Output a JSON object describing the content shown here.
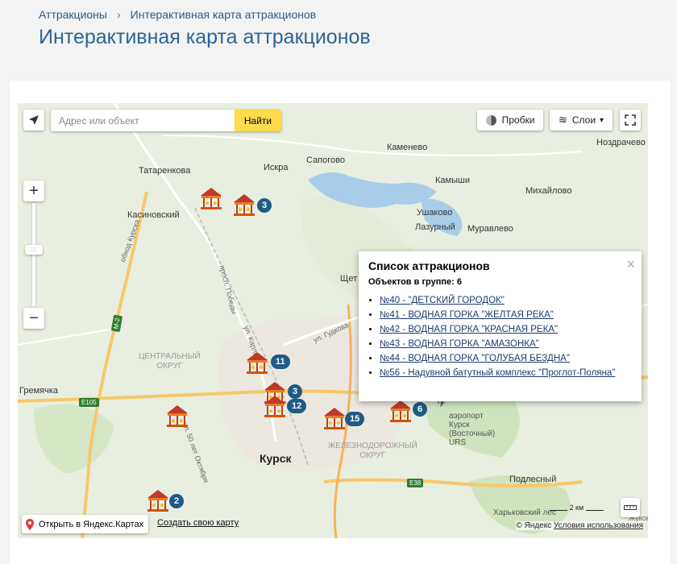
{
  "breadcrumbs": [
    "Аттракционы",
    "Интерактивная карта аттракционов"
  ],
  "breadcrumb_separator": "›",
  "page_title": "Интерактивная карта аттракционов",
  "map": {
    "search_placeholder": "Адрес или объект",
    "search_button": "Найти",
    "traffic_button": "Пробки",
    "layers_button": "Слои",
    "open_in_yandex": "Открыть в Яндекс.Картах",
    "create_map": "Создать свою карту",
    "copyright": "© Яндекс",
    "terms": "Условия использования",
    "scale_label": "2 км",
    "labels": {
      "kamenevo": "Каменево",
      "nozdrachevo": "Ноздрачево",
      "tatarenkova": "Татаренкова",
      "iskra": "Искра",
      "sapogovo": "Сапогово",
      "kamyshi": "Камыши",
      "mikhailovo": "Михайлово",
      "kasinovsky": "Касиновский",
      "ushakovo": "Ушаково",
      "lazurny": "Лазурный",
      "muravlevo": "Муравлево",
      "shchet": "Щет",
      "central_district": "ЦЕНТРАЛЬНЫЙ\nОКРУГ",
      "railway_district": "ЖЕЛЕЗНОДОРОЖНЫЙ\nОКРУГ",
      "kursk": "Курск",
      "gremyachka": "Гремячка",
      "airport": "аэропорт\nКурск\n(Восточный)\nURS",
      "podlesny": "Подлесный",
      "kharkov_forest": "Харьковский лес",
      "road_obkhod": "обход Курска",
      "road_pobedy": "просп. Победы",
      "road_karla": "ул. Карла",
      "road_gudkova": "ул. Гудкова",
      "road_oktyabrya": "ул. 50 лет Октября",
      "m2": "М-2",
      "e105": "E105",
      "e38": "E38",
      "zhukova": "Жукова"
    },
    "clusters": [
      {
        "count": "3"
      },
      {
        "count": "11"
      },
      {
        "count": "3"
      },
      {
        "count": "12"
      },
      {
        "count": "15"
      },
      {
        "count": "6"
      },
      {
        "count": "2"
      }
    ]
  },
  "balloon": {
    "title": "Список аттракционов",
    "count_text": "Объектов в группе: 6",
    "close": "×",
    "items": [
      "№40 - \"ДЕТСКИЙ ГОРОДОК\"",
      "№41 - ВОДНАЯ ГОРКА \"ЖЕЛТАЯ РЕКА\"",
      "№42 - ВОДНАЯ ГОРКА \"КРАСНАЯ РЕКА\"",
      "№43 - ВОДНАЯ ГОРКА \"АМАЗОНКА\"",
      "№44 - ВОДНАЯ ГОРКА \"ГОЛУБАЯ БЕЗДНА\"",
      "№56 - Надувной батутный комплекс \"Проглот-Поляна\""
    ]
  },
  "colors": {
    "title": "#2c6496",
    "cluster_badge": "#1f5b86",
    "search_button": "#ffdb4d",
    "marker": "#c0392b"
  }
}
